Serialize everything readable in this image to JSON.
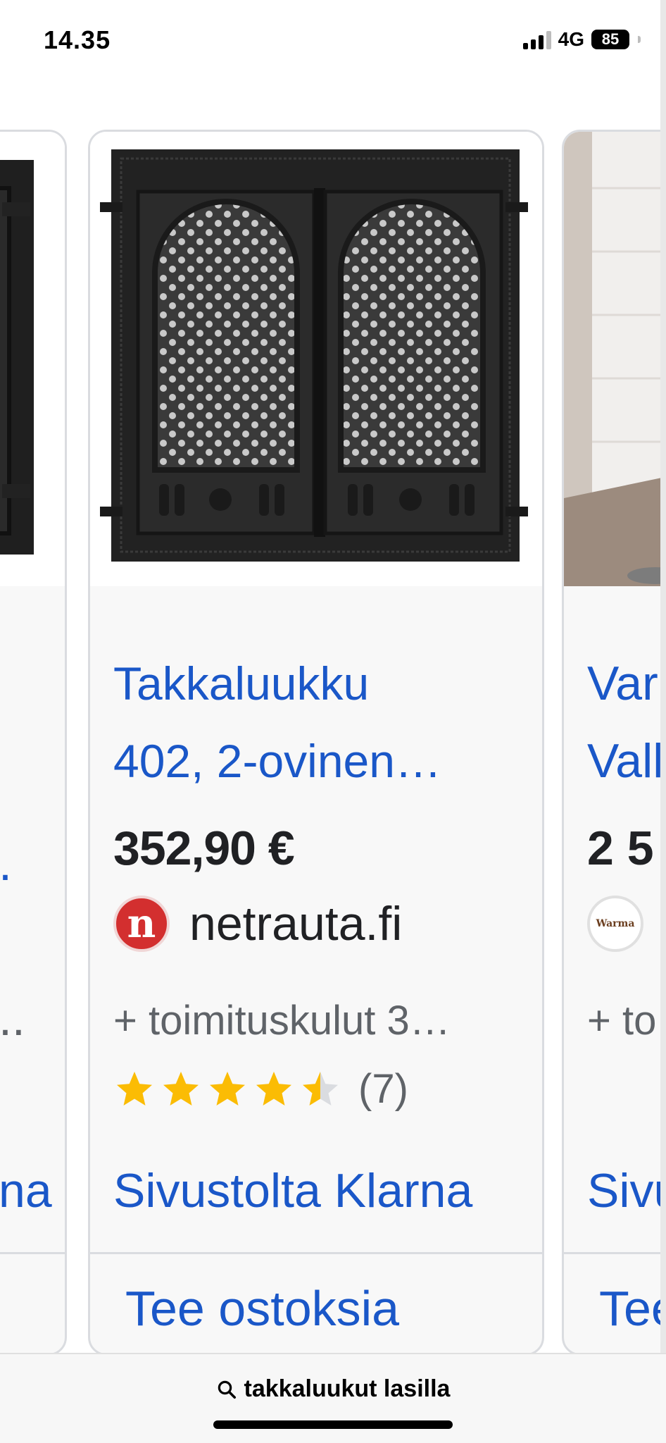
{
  "status_bar": {
    "time": "14.35",
    "network": "4G",
    "battery": "85"
  },
  "search": {
    "query": "takkaluukut lasilla"
  },
  "products": {
    "main": {
      "title_line1": "Takkaluukku",
      "title_line2": "402, 2-ovinen…",
      "price": "352,90 €",
      "store_logo_letter": "n",
      "store": "netrauta.fi",
      "shipping": "+ toimituskulut 3…",
      "rating": 4.5,
      "review_count": "(7)",
      "klarna_link": "Sivustolta Klarna",
      "shop_button": "Tee ostoksia"
    },
    "left_peek": {
      "title_fragment": ".",
      "shipping_fragment": "..",
      "klarna_fragment": "na"
    },
    "right_peek": {
      "title_line1": "Var",
      "title_line2": "Vall",
      "price": "2 5",
      "store_logo_text": "Warma",
      "shipping": "+ to",
      "klarna_fragment": "Sivu",
      "shop_fragment": "Tee"
    }
  },
  "colors": {
    "link_blue": "#1a57c8",
    "star_gold": "#fbbc04",
    "store_red": "#d32f2f"
  }
}
